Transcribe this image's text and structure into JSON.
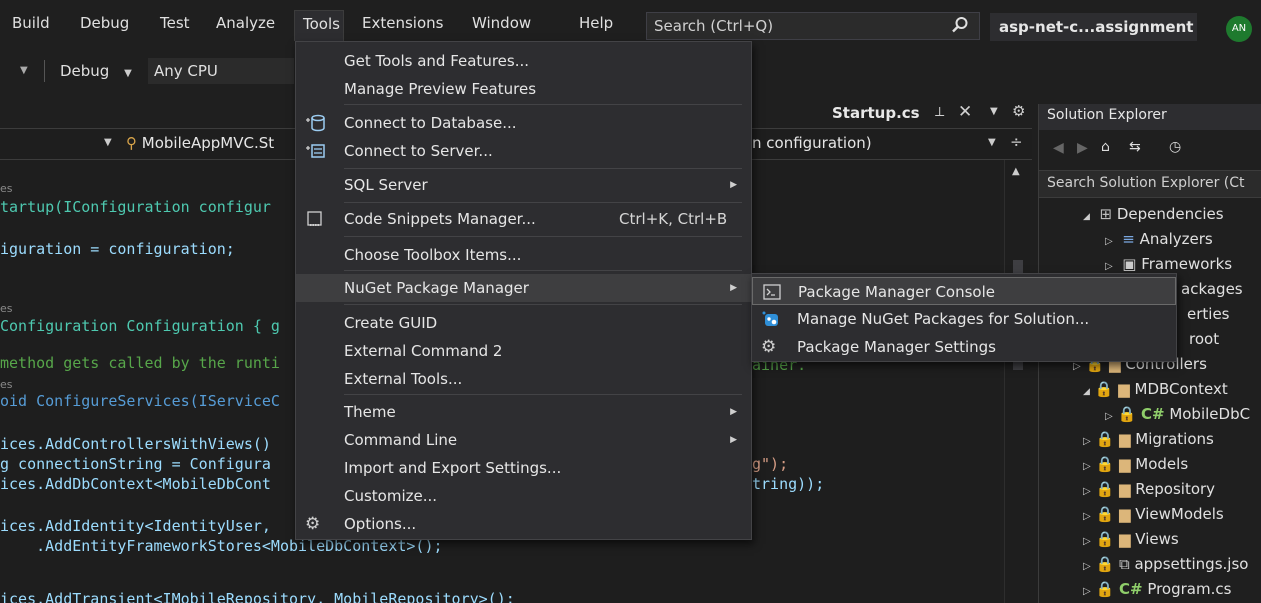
{
  "menubar": {
    "items": [
      "Build",
      "Debug",
      "Test",
      "Analyze",
      "Tools",
      "Extensions",
      "Window",
      "Help"
    ],
    "search_placeholder": "Search (Ctrl+Q)",
    "solution_name": "asp-net-c...assignment",
    "avatar_initials": "AN"
  },
  "toolbar": {
    "config": "Debug",
    "platform": "Any CPU"
  },
  "editor": {
    "tab_title": "Startup.cs",
    "nav_class": "MobileAppMVC.St",
    "nav_member": "n configuration)",
    "code_lines": [
      {
        "ref": "es"
      },
      {
        "text": "tartup(IConfiguration configur"
      },
      {
        "text": "iguration = configuration;"
      },
      {
        "ref": "es"
      },
      {
        "text": "Configuration Configuration { g"
      },
      {
        "comment": "method gets called by the runti"
      },
      {
        "ref": "es"
      },
      {
        "text": "oid ConfigureServices(IServiceC"
      },
      {
        "text": "ices.AddControllersWithViews()"
      },
      {
        "text": "g connectionString = Configura"
      },
      {
        "text": "ices.AddDbContext<MobileDbCont"
      },
      {
        "text": "ices.AddIdentity<IdentityUser,"
      },
      {
        "text": "    .AddEntityFrameworkStores<MobileDbContext>();"
      },
      {
        "text": "ices.AddTransient<IMobileRepository, MobileRepository>();"
      }
    ],
    "right_fragments": [
      "ainer.",
      "g\");",
      "tring));"
    ]
  },
  "solution_explorer": {
    "title": "Solution Explorer",
    "search_placeholder": "Search Solution Explorer (Ct",
    "nodes": [
      "Dependencies",
      "Analyzers",
      "Frameworks",
      "ackages",
      "erties",
      "root",
      "Controllers",
      "MDBContext",
      "MobileDbC",
      "Migrations",
      "Models",
      "Repository",
      "ViewModels",
      "Views",
      "appsettings.jso",
      "Program.cs"
    ]
  },
  "tools_menu": {
    "items": [
      {
        "label": "Get Tools and Features..."
      },
      {
        "label": "Manage Preview Features"
      },
      {
        "label": "Connect to Database..."
      },
      {
        "label": "Connect to Server..."
      },
      {
        "label": "SQL Server"
      },
      {
        "label": "Code Snippets Manager...",
        "shortcut": "Ctrl+K, Ctrl+B"
      },
      {
        "label": "Choose Toolbox Items..."
      },
      {
        "label": "NuGet Package Manager"
      },
      {
        "label": "Create GUID"
      },
      {
        "label": "External Command 2"
      },
      {
        "label": "External Tools..."
      },
      {
        "label": "Theme"
      },
      {
        "label": "Command Line"
      },
      {
        "label": "Import and Export Settings..."
      },
      {
        "label": "Customize..."
      },
      {
        "label": "Options..."
      }
    ]
  },
  "nuget_menu": {
    "items": [
      {
        "label": "Package Manager Console"
      },
      {
        "label": "Manage NuGet Packages for Solution..."
      },
      {
        "label": "Package Manager Settings"
      }
    ]
  },
  "colors": {
    "menu_bg": "#2d2d30",
    "highlight": "#3e3e40",
    "keyword": "#569cd6",
    "type": "#4ec9b0",
    "comment": "#57a64a"
  }
}
